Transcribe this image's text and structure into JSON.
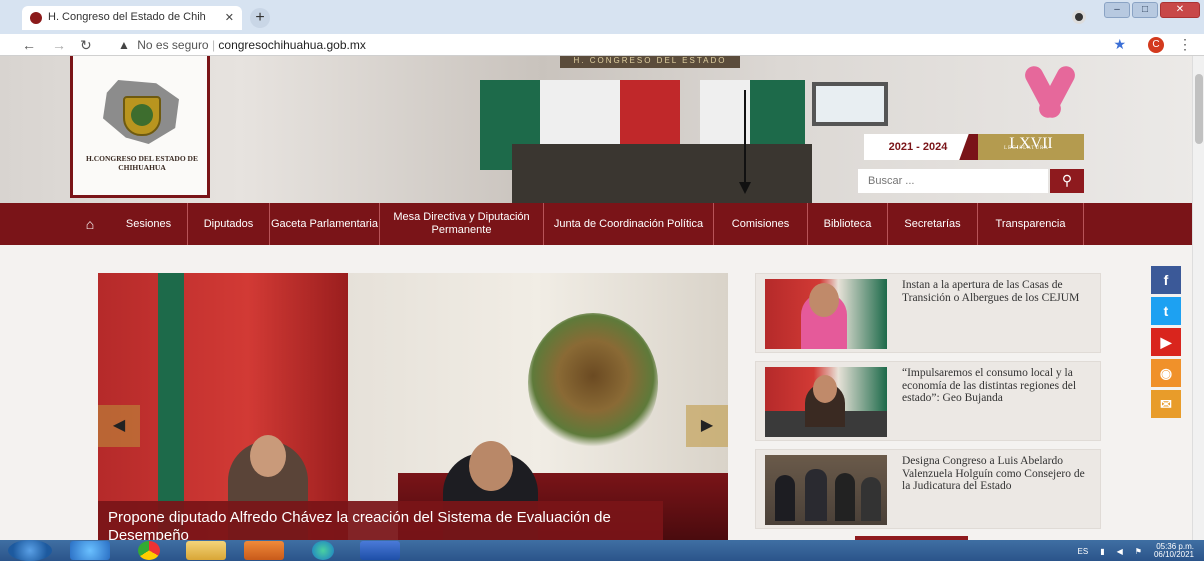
{
  "browser": {
    "tab_title": "H. Congreso del Estado de Chih",
    "tab_close": "✕",
    "new_tab": "+",
    "security_label": "No es seguro",
    "url": "congresochihuahua.gob.mx",
    "profile_initial": "C",
    "window_minimize": "–",
    "window_maximize": "□",
    "window_close": "✕"
  },
  "header": {
    "logo_text": "H.CONGRESO DEL ESTADO DE CHIHUAHUA",
    "ceiling_text": "H. CONGRESO DEL ESTADO",
    "legislature_years": "2021 - 2024",
    "legislature_number": "LXVII",
    "legislature_word": "LEGISLATURA",
    "search_placeholder": "Buscar ..."
  },
  "nav": {
    "items": [
      {
        "label": "Sesiones"
      },
      {
        "label": "Diputados"
      },
      {
        "label": "Gaceta Parlamentaria"
      },
      {
        "label": "Mesa Directiva y Diputación Permanente"
      },
      {
        "label": "Junta de Coordinación Política"
      },
      {
        "label": "Comisiones"
      },
      {
        "label": "Biblioteca"
      },
      {
        "label": "Secretarías"
      },
      {
        "label": "Transparencia"
      }
    ]
  },
  "slider": {
    "caption": "Propone diputado Alfredo Chávez la creación del Sistema de Evaluación de Desempeño"
  },
  "news": [
    {
      "title": "Instan a la apertura de las Casas de Transición o Albergues de los CEJUM"
    },
    {
      "title": "“Impulsaremos el consumo local y la economía de las distintas regiones del estado”: Geo Bujanda"
    },
    {
      "title": "Designa Congreso a Luis Abelardo Valenzuela Holguín como Consejero de la Judicatura del Estado"
    }
  ],
  "social": [
    {
      "icon": "facebook-icon",
      "glyph": "f",
      "color": "#3b5998"
    },
    {
      "icon": "twitter-icon",
      "glyph": "t",
      "color": "#1da1f2"
    },
    {
      "icon": "youtube-icon",
      "glyph": "▶",
      "color": "#d9251d"
    },
    {
      "icon": "rss-icon",
      "glyph": "◉",
      "color": "#f0912a"
    },
    {
      "icon": "email-icon",
      "glyph": "✉",
      "color": "#e89c2a"
    }
  ],
  "taskbar": {
    "language": "ES",
    "time": "05:36 p.m.",
    "date": "06/10/2021"
  },
  "colors": {
    "brand": "#7a1418",
    "accent_gold": "#b49b4f"
  }
}
